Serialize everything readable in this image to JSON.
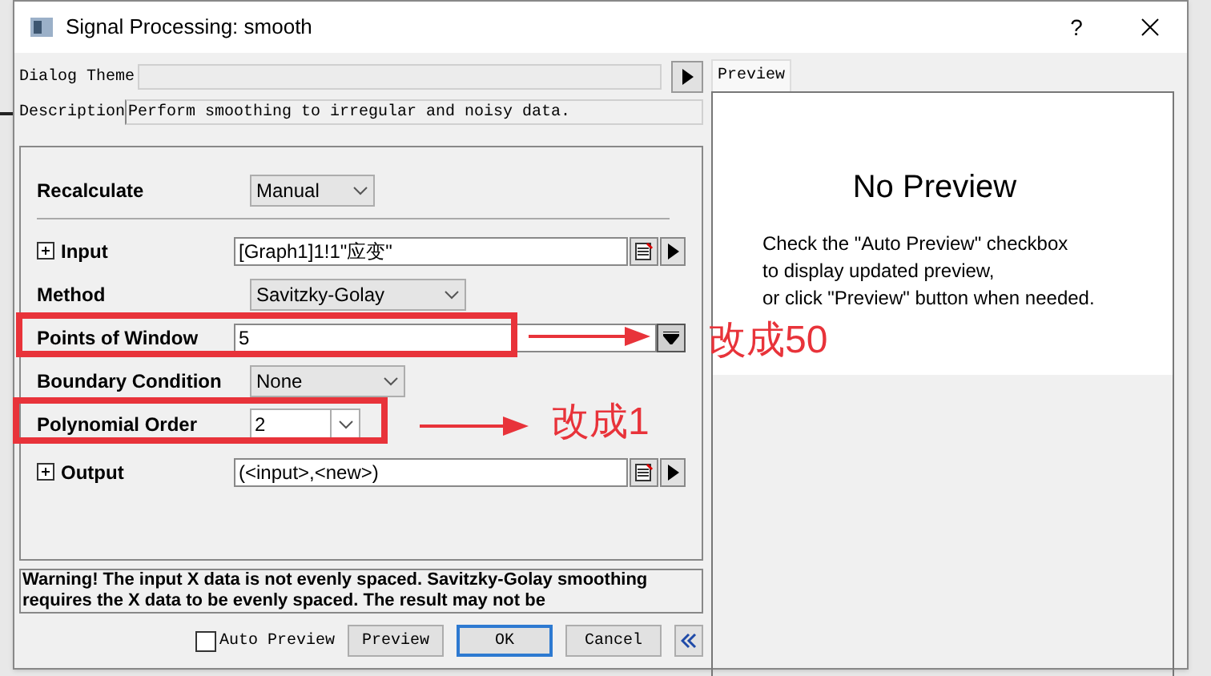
{
  "window": {
    "title": "Signal Processing: smooth",
    "help": "?"
  },
  "dialog_theme": {
    "label": "Dialog Theme"
  },
  "description": {
    "label": "Description",
    "value": "Perform smoothing to irregular and noisy data."
  },
  "params": [
    {
      "kind": "dropdown",
      "label": "Recalculate",
      "value": "Manual"
    },
    {
      "kind": "group",
      "label": "Input",
      "value": "[Graph1]1!1\"应变\"",
      "expanded": false
    },
    {
      "kind": "dropdown",
      "label": "Method",
      "value": "Savitzky-Golay"
    },
    {
      "kind": "combo",
      "label": "Points of Window",
      "value": "5"
    },
    {
      "kind": "dropdown",
      "label": "Boundary Condition",
      "value": "None"
    },
    {
      "kind": "spin",
      "label": "Polynomial Order",
      "value": "2"
    },
    {
      "kind": "group",
      "label": "Output",
      "value": "(<input>,<new>)",
      "expanded": false
    }
  ],
  "warning": "Warning! The input X data is not evenly spaced. Savitzky-Golay smoothing requires the X data to be evenly spaced. The result may not be",
  "auto_preview": {
    "label": "Auto Preview",
    "checked": false
  },
  "buttons": [
    {
      "label": "Preview",
      "selected": false
    },
    {
      "label": "OK",
      "selected": true
    },
    {
      "label": "Cancel",
      "selected": false
    }
  ],
  "preview": {
    "tab": "Preview",
    "heading": "No Preview",
    "lines": [
      "Check the \"Auto Preview\" checkbox",
      "to display updated preview,",
      "or click \"Preview\" button when needed."
    ]
  },
  "annotations": [
    {
      "text": "改成50"
    },
    {
      "text": "改成1"
    }
  ]
}
